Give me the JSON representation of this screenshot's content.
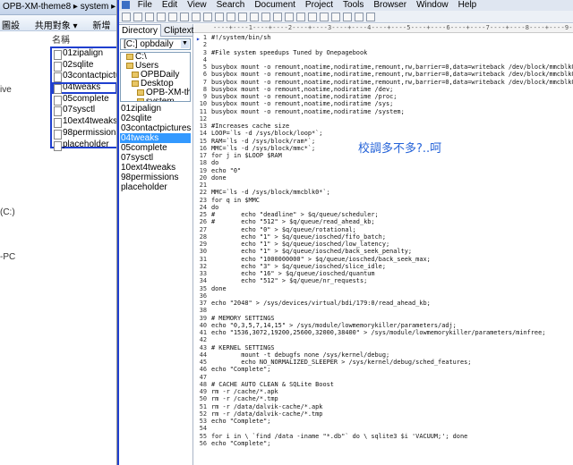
{
  "explorer": {
    "breadcrumb": "OPB-XM-theme8 ▸ system ▸ etc",
    "toolbar": [
      "圖設",
      "共用對象 ▾",
      "新增"
    ],
    "column_header": "名稱",
    "side_labels": [
      "ive",
      "(C:)",
      "-PC"
    ],
    "files": [
      {
        "name": "01zipalign",
        "highlighted": false
      },
      {
        "name": "02sqlite",
        "highlighted": false
      },
      {
        "name": "03contactpictures",
        "highlighted": false
      },
      {
        "name": "04tweaks",
        "highlighted": true
      },
      {
        "name": "05complete",
        "highlighted": false
      },
      {
        "name": "07sysctl",
        "highlighted": false
      },
      {
        "name": "10ext4tweaks",
        "highlighted": false
      },
      {
        "name": "98permissions",
        "highlighted": false
      },
      {
        "name": "placeholder",
        "highlighted": false
      }
    ]
  },
  "editor": {
    "menu": [
      "File",
      "Edit",
      "View",
      "Search",
      "Document",
      "Project",
      "Tools",
      "Browser",
      "Window",
      "Help"
    ],
    "tabs": {
      "directory": "Directory",
      "cliptext": "Cliptext"
    },
    "drive": "[C:] opbdaily",
    "tree": [
      {
        "label": "C:\\",
        "indent": 1
      },
      {
        "label": "Users",
        "indent": 1
      },
      {
        "label": "OPBDaily",
        "indent": 2
      },
      {
        "label": "Desktop",
        "indent": 2
      },
      {
        "label": "OPB-XM-theme8",
        "indent": 3
      },
      {
        "label": "system",
        "indent": 3
      }
    ],
    "project_files": [
      {
        "name": "01zipalign",
        "selected": false
      },
      {
        "name": "02sqlite",
        "selected": false
      },
      {
        "name": "03contactpictures",
        "selected": false
      },
      {
        "name": "04tweaks",
        "selected": true
      },
      {
        "name": "05complete",
        "selected": false
      },
      {
        "name": "07sysctl",
        "selected": false
      },
      {
        "name": "10ext4tweaks",
        "selected": false
      },
      {
        "name": "98permissions",
        "selected": false
      },
      {
        "name": "placeholder",
        "selected": false
      }
    ],
    "ruler": "----+----1----+----2----+----3----+----4----+----5----+----6----+----7----+----8----+----9----+----0----",
    "code_lines": [
      {
        "n": "1",
        "t": "#!/system/bin/sh"
      },
      {
        "n": "2",
        "t": ""
      },
      {
        "n": "3",
        "t": "#File system speedups Tuned by Onepagebook"
      },
      {
        "n": "4",
        "t": ""
      },
      {
        "n": "5",
        "t": "busybox mount -o remount,noatime,nodiratime,remount,rw,barrier=0,data=writeback /dev/block/mmcblk0p15"
      },
      {
        "n": "6",
        "t": "busybox mount -o remount,noatime,nodiratime,remount,rw,barrier=0,data=writeback /dev/block/mmcblk0p13"
      },
      {
        "n": "7",
        "t": "busybox mount -o remount,noatime,nodiratime,remount,rw,barrier=0,data=writeback /dev/block/mmcblk0p12"
      },
      {
        "n": "8",
        "t": "busybox mount -o remount,noatime,nodiratime /dev;"
      },
      {
        "n": "9",
        "t": "busybox mount -o remount,noatime,nodiratime /proc;"
      },
      {
        "n": "10",
        "t": "busybox mount -o remount,noatime,nodiratime /sys;"
      },
      {
        "n": "11",
        "t": "busybox mount -o remount,noatime,nodiratime /system;"
      },
      {
        "n": "12",
        "t": ""
      },
      {
        "n": "13",
        "t": "#Increases cache size"
      },
      {
        "n": "14",
        "t": "LOOP=`ls -d /sys/block/loop*`;"
      },
      {
        "n": "15",
        "t": "RAM=`ls -d /sys/block/ram*`;"
      },
      {
        "n": "16",
        "t": "MMC=`ls -d /sys/block/mmc*`;"
      },
      {
        "n": "17",
        "t": "for j in $LOOP $RAM"
      },
      {
        "n": "18",
        "t": "do"
      },
      {
        "n": "19",
        "t": "echo \"0\""
      },
      {
        "n": "20",
        "t": "done"
      },
      {
        "n": "21",
        "t": ""
      },
      {
        "n": "22",
        "t": "MMC=`ls -d /sys/block/mmcblk0*`;"
      },
      {
        "n": "23",
        "t": "for q in $MMC"
      },
      {
        "n": "24",
        "t": "do"
      },
      {
        "n": "25",
        "t": "#       echo \"deadline\" > $q/queue/scheduler;"
      },
      {
        "n": "26",
        "t": "#       echo \"512\" > $q/queue/read_ahead_kb;"
      },
      {
        "n": "27",
        "t": "        echo \"0\" > $q/queue/rotational;"
      },
      {
        "n": "28",
        "t": "        echo \"1\" > $q/queue/iosched/fifo_batch;"
      },
      {
        "n": "29",
        "t": "        echo \"1\" > $q/queue/iosched/low_latency;"
      },
      {
        "n": "30",
        "t": "        echo \"1\" > $q/queue/iosched/back_seek_penalty;"
      },
      {
        "n": "31",
        "t": "        echo \"1000000000\" > $q/queue/iosched/back_seek_max;"
      },
      {
        "n": "32",
        "t": "        echo \"3\" > $q/queue/iosched/slice_idle;"
      },
      {
        "n": "33",
        "t": "        echo \"16\" > $q/queue/iosched/quantum"
      },
      {
        "n": "34",
        "t": "        echo \"512\" > $q/queue/nr_requests;"
      },
      {
        "n": "35",
        "t": "done"
      },
      {
        "n": "36",
        "t": ""
      },
      {
        "n": "37",
        "t": "echo \"2048\" > /sys/devices/virtual/bdi/179:0/read_ahead_kb;"
      },
      {
        "n": "38",
        "t": ""
      },
      {
        "n": "39",
        "t": "# MEMORY SETTINGS"
      },
      {
        "n": "40",
        "t": "echo \"0,3,5,7,14,15\" > /sys/module/lowmemorykiller/parameters/adj;"
      },
      {
        "n": "41",
        "t": "echo \"1536,3072,19200,25600,32000,38400\" > /sys/module/lowmemorykiller/parameters/minfree;"
      },
      {
        "n": "42",
        "t": ""
      },
      {
        "n": "43",
        "t": "# KERNEL SETTINGS"
      },
      {
        "n": "44",
        "t": "        mount -t debugfs none /sys/kernel/debug;"
      },
      {
        "n": "45",
        "t": "        echo NO_NORMALIZED_SLEEPER > /sys/kernel/debug/sched_features;"
      },
      {
        "n": "46",
        "t": "echo \"Complete\";"
      },
      {
        "n": "47",
        "t": ""
      },
      {
        "n": "48",
        "t": "# CACHE AUTO CLEAN & SQLite Boost"
      },
      {
        "n": "49",
        "t": "rm -r /cache/*.apk"
      },
      {
        "n": "50",
        "t": "rm -r /cache/*.tmp"
      },
      {
        "n": "51",
        "t": "rm -r /data/dalvik-cache/*.apk"
      },
      {
        "n": "52",
        "t": "rm -r /data/dalvik-cache/*.tmp"
      },
      {
        "n": "53",
        "t": "echo \"Complete\";"
      },
      {
        "n": "54",
        "t": ""
      },
      {
        "n": "55",
        "t": "for i in \\ `find /data -iname \"*.db\"` do \\ sqlite3 $i 'VACUUM;'; done"
      },
      {
        "n": "56",
        "t": "echo \"Complete\";"
      }
    ]
  },
  "annotation": "校調多不多?..呵",
  "colors": {
    "highlight_border": "#1f3fcf",
    "selection": "#3399ff",
    "annotation": "#2563d8"
  }
}
